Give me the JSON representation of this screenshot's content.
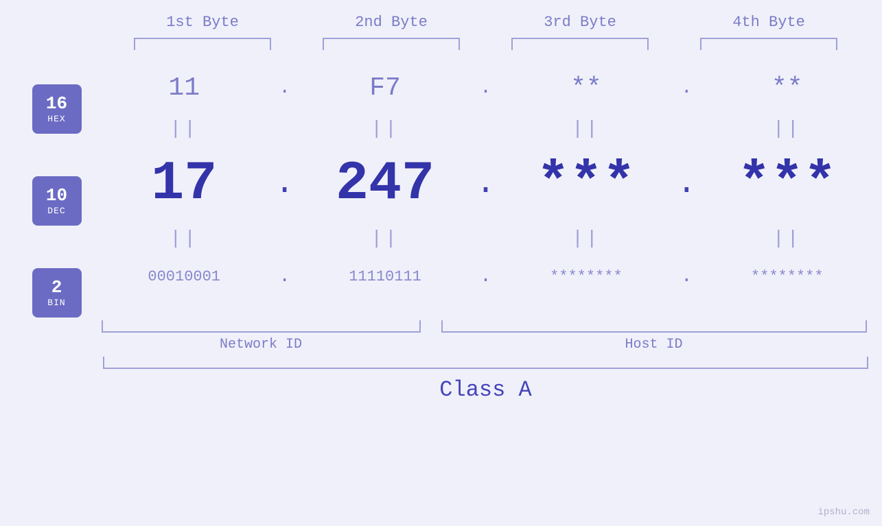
{
  "byteHeaders": [
    "1st Byte",
    "2nd Byte",
    "3rd Byte",
    "4th Byte"
  ],
  "badges": [
    {
      "number": "16",
      "label": "HEX"
    },
    {
      "number": "10",
      "label": "DEC"
    },
    {
      "number": "2",
      "label": "BIN"
    }
  ],
  "hexValues": [
    "11",
    "F7",
    "**",
    "**"
  ],
  "decValues": [
    "17",
    "247",
    "***",
    "***"
  ],
  "binValues": [
    "00010001",
    "11110111",
    "********",
    "********"
  ],
  "dots": {
    "hex": ".",
    "dec": ".",
    "bin": "."
  },
  "separator": "||",
  "networkIdLabel": "Network ID",
  "hostIdLabel": "Host ID",
  "classLabel": "Class A",
  "watermark": "ipshu.com"
}
